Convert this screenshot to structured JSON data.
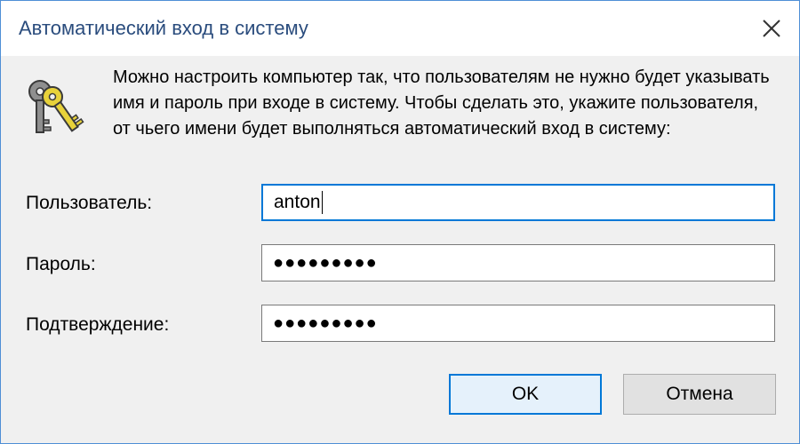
{
  "dialog": {
    "title": "Автоматический вход в систему",
    "description": "Можно настроить компьютер так, что пользователям не нужно будет указывать имя и пароль при входе в систему. Чтобы сделать это, укажите пользователя, от чьего имени будет выполняться автоматический вход в систему:",
    "fields": {
      "user": {
        "label": "Пользователь:",
        "value": "anton"
      },
      "password": {
        "label": "Пароль:",
        "value": "●●●●●●●●●"
      },
      "confirm": {
        "label": "Подтверждение:",
        "value": "●●●●●●●●●"
      }
    },
    "buttons": {
      "ok": "OK",
      "cancel": "Отмена"
    }
  },
  "icons": {
    "close": "close-icon",
    "keys": "keys-icon"
  },
  "colors": {
    "title_text": "#2a4c7d",
    "accent": "#0078d7",
    "window_border": "#4f8fd6",
    "dialog_bg": "#f0f0f0"
  }
}
